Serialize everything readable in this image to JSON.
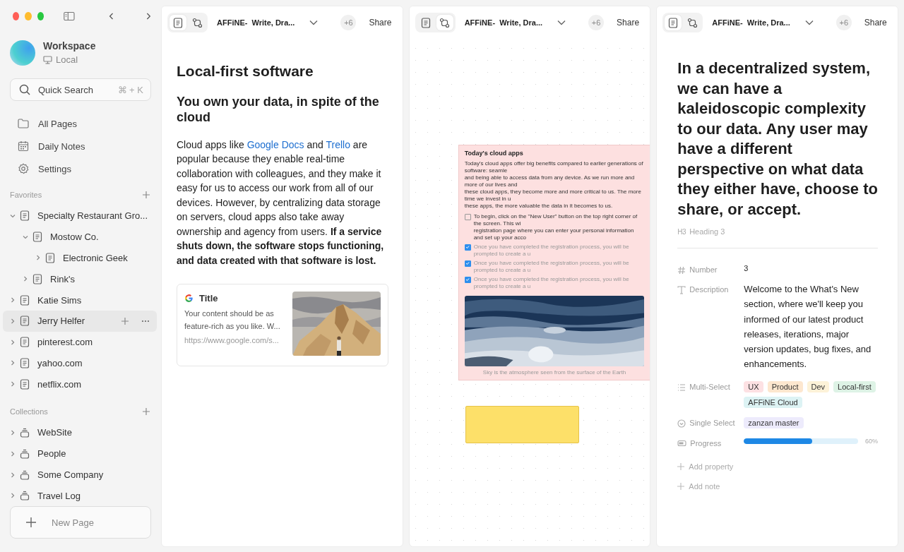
{
  "workspace": {
    "name": "Workspace",
    "location": "Local"
  },
  "search": {
    "placeholder": "Quick Search",
    "shortcut": "⌘ + K"
  },
  "nav": [
    {
      "kind": "pages",
      "label": "All Pages"
    },
    {
      "kind": "daily",
      "label": "Daily Notes"
    },
    {
      "kind": "settings",
      "label": "Settings"
    }
  ],
  "favorites": {
    "title": "Favorites",
    "items": [
      {
        "label": "Specialty Restaurant Gro...",
        "expanded": true,
        "selected": false,
        "children": [
          {
            "label": "Mostow Co.",
            "expanded": true,
            "selected": false,
            "children": [
              {
                "label": "Electronic Geek",
                "expanded": false,
                "selected": false
              }
            ]
          },
          {
            "label": "Rink's",
            "expanded": false,
            "selected": false
          }
        ]
      },
      {
        "label": "Katie Sims",
        "expanded": false,
        "selected": false
      },
      {
        "label": "Jerry Helfer",
        "expanded": false,
        "selected": true
      },
      {
        "label": "pinterest.com",
        "expanded": false,
        "selected": false
      },
      {
        "label": "yahoo.com",
        "expanded": false,
        "selected": false
      },
      {
        "label": "netflix.com",
        "expanded": false,
        "selected": false
      }
    ]
  },
  "collections": {
    "title": "Collections",
    "items": [
      {
        "label": "WebSite"
      },
      {
        "label": "People"
      },
      {
        "label": "Some Company"
      },
      {
        "label": "Travel Log"
      }
    ]
  },
  "new_page": "New Page",
  "panels": [
    {
      "modes": [
        {
          "kind": "page",
          "selected": true
        },
        {
          "kind": "edgeless",
          "selected": false
        }
      ],
      "title": "AFFiNE-  Write, Dra...",
      "members": "+6",
      "share": "Share"
    },
    {
      "modes": [
        {
          "kind": "page",
          "selected": false
        },
        {
          "kind": "edgeless",
          "selected": true
        }
      ],
      "title": "AFFiNE-  Write, Dra...",
      "members": "+6",
      "share": "Share"
    },
    {
      "modes": [
        {
          "kind": "page",
          "selected": true
        },
        {
          "kind": "edgeless",
          "selected": false
        }
      ],
      "title": "AFFiNE-  Write, Dra...",
      "members": "+6",
      "share": "Share"
    }
  ],
  "doc": {
    "title": "Local-first software",
    "subtitle": "You own your data, in spite of the cloud",
    "paragraph": [
      {
        "kind": "text",
        "text": "Cloud apps like "
      },
      {
        "kind": "link",
        "text": "Google Docs"
      },
      {
        "kind": "text",
        "text": " and "
      },
      {
        "kind": "link",
        "text": "Trello"
      },
      {
        "kind": "text",
        "text": " are popular because they enable real-time collaboration with colleagues, and they make it easy for us to access our work from all of our devices. However, by centralizing data storage on servers, cloud apps also take away ownership and agency from users. "
      },
      {
        "kind": "bold",
        "text": "If a service shuts down, the software stops functioning, and data created with that software is lost."
      }
    ],
    "link_card": {
      "title": "Title",
      "description": "Your content should be as feature-rich as you like. W...",
      "url": "https://www.google.com/s...",
      "kind": "picture"
    }
  },
  "canvas": {
    "note": {
      "title": "Today's cloud apps",
      "lines": [
        "Today's cloud apps offer big benefits compared to earlier generations of software: seamle",
        "and being able to access data from any device. As we run more and more of our lives and",
        "these cloud apps, they become more and more critical to us. The more time we invest in u",
        "these apps, the more valuable the data in it becomes to us."
      ],
      "todos": [
        {
          "checked": false,
          "lines": [
            "To begin, click on the \"New User\" button on the top right corner of the screen. This wi",
            "registration page where you can enter your personal information and set up your acco"
          ]
        },
        {
          "checked": true,
          "lines": [
            "Once you have completed the registration process, you will be prompted to create a u"
          ]
        },
        {
          "checked": true,
          "lines": [
            "Once you have completed the registration process, you will be prompted to create a u"
          ]
        },
        {
          "checked": true,
          "lines": [
            "Once you have completed the registration process, you will be prompted to create a u"
          ]
        }
      ],
      "caption": "Sky is the atmosphere seen from the surface of the Earth"
    },
    "shape": {
      "color": "#fde069"
    }
  },
  "right_doc": {
    "heading": "In a decentralized system, we can have a kaleidoscopic complexity to our data. Any user may have a different perspective on what data they either have, choose to share, or accept.",
    "block_badge": "H3",
    "block_type": "Heading 3",
    "properties": [
      {
        "kind": "number",
        "label": "Number",
        "value": "3"
      },
      {
        "kind": "text",
        "label": "Description",
        "value": "Welcome to the What's New section, where we'll keep you informed of our latest product releases, iterations, major version updates, bug fixes, and enhancements."
      },
      {
        "kind": "multi",
        "label": "Multi-Select",
        "tags": [
          {
            "text": "UX",
            "color": "#fde1e3"
          },
          {
            "text": "Product",
            "color": "#fde7cf"
          },
          {
            "text": "Dev",
            "color": "#fdf2d8"
          },
          {
            "text": "Local-first",
            "color": "#def3e6"
          },
          {
            "text": "AFFiNE Cloud",
            "color": "#ddf3f4"
          }
        ]
      },
      {
        "kind": "single",
        "label": "Single Select",
        "tags": [
          {
            "text": "zanzan master",
            "color": "#edebfc"
          }
        ]
      },
      {
        "kind": "progress",
        "label": "Progress",
        "level": 0.6,
        "reading": "60%"
      }
    ],
    "add_property": "Add property",
    "add_note": "Add note"
  }
}
